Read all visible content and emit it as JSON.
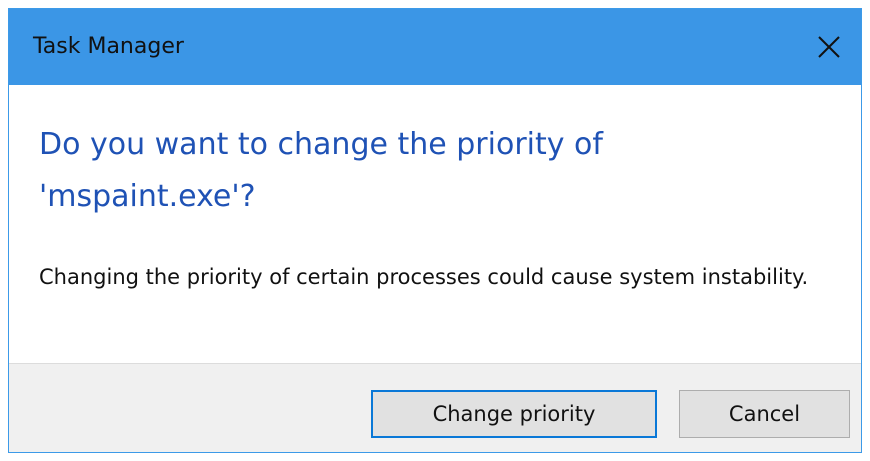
{
  "window": {
    "title": "Task Manager",
    "close_icon": "close-icon"
  },
  "dialog": {
    "main_instruction": "Do you want to change the priority of 'mspaint.exe'?",
    "detail": "Changing the priority of certain processes could cause system instability."
  },
  "buttons": {
    "change_priority": "Change priority",
    "cancel": "Cancel"
  },
  "colors": {
    "titlebar": "#3b96e6",
    "instruction_text": "#1f52b5",
    "default_button_border": "#0a78d7"
  }
}
